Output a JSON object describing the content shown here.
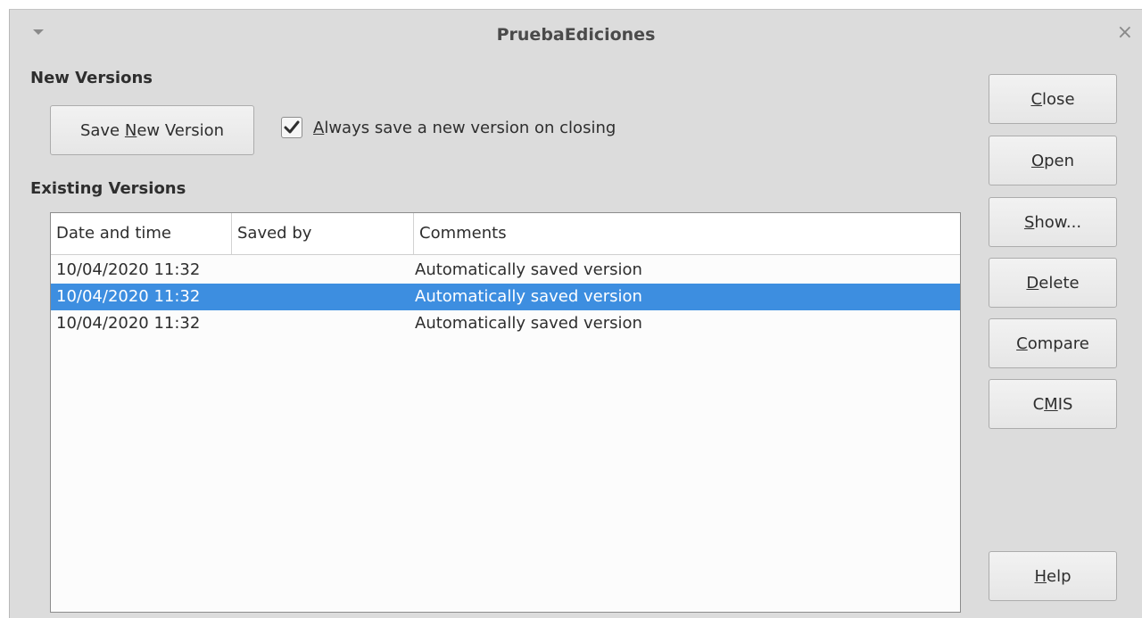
{
  "window": {
    "title": "PruebaEdiciones",
    "menu_icon": "chevron-down-icon",
    "close_icon": "close-icon"
  },
  "new_versions": {
    "heading": "New Versions",
    "save_button": {
      "pre": "Save ",
      "accel": "N",
      "post": "ew Version"
    },
    "always_save_checkbox": {
      "checked": true,
      "pre": "",
      "accel": "A",
      "post": "lways save a new version on closing"
    }
  },
  "existing_versions": {
    "heading": "Existing Versions",
    "columns": [
      "Date and time",
      "Saved by",
      "Comments"
    ],
    "rows": [
      {
        "date": "10/04/2020 11:32",
        "saved_by": "",
        "comment": "Automatically saved version",
        "selected": false
      },
      {
        "date": "10/04/2020 11:32",
        "saved_by": "",
        "comment": "Automatically saved version",
        "selected": true
      },
      {
        "date": "10/04/2020 11:32",
        "saved_by": "",
        "comment": "Automatically saved version",
        "selected": false
      }
    ]
  },
  "side_buttons": [
    {
      "name": "close-button",
      "accel": "C",
      "rest": "lose"
    },
    {
      "name": "open-button",
      "accel": "O",
      "rest": "pen"
    },
    {
      "name": "show-button",
      "accel": "S",
      "rest": "how..."
    },
    {
      "name": "delete-button",
      "accel": "D",
      "rest": "elete"
    },
    {
      "name": "compare-button",
      "accel": "C",
      "rest": "ompare"
    },
    {
      "name": "cmis-button",
      "pre": "C",
      "accel": "M",
      "rest": "IS"
    },
    {
      "name": "help-button",
      "accel": "H",
      "rest": "elp"
    }
  ],
  "colors": {
    "selection": "#3d8ee0",
    "dialog_bg": "#dcdcdc"
  }
}
